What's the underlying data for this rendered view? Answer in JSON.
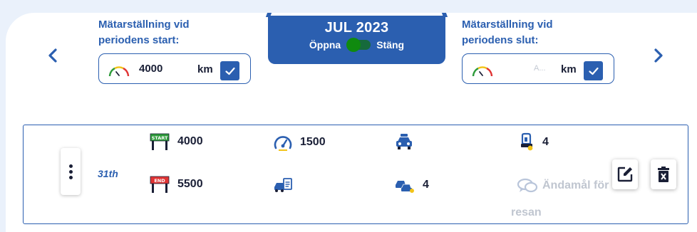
{
  "nav": {
    "prev_icon": "chevron-left-icon",
    "next_icon": "chevron-right-icon"
  },
  "start_reading": {
    "label_line1": "Mätarställning vid",
    "label_line2": "periodens start:",
    "value": "4000",
    "unit": "km",
    "icon": "speedometer-icon"
  },
  "end_reading": {
    "label_line1": "Mätarställning vid",
    "label_line2": "periodens slut:",
    "value": "",
    "placeholder": "A...",
    "unit": "km",
    "icon": "speedometer-icon"
  },
  "period": {
    "title": "JUL 2023",
    "open_label": "Öppna",
    "close_label": "Stäng",
    "toggle_state": "open"
  },
  "trip": {
    "day": "31th",
    "start_odometer": "4000",
    "end_odometer": "5500",
    "distance": "1500",
    "passengers": "4",
    "cars": "4",
    "purpose_placeholder": "Ändamål för resan"
  },
  "colors": {
    "accent": "#2b5fb0",
    "background": "#eaf1fb",
    "toggle_green": "#0f8a0f",
    "start_sign": "#2e9b3a",
    "end_sign": "#e03434",
    "highlight_yellow": "#f2c318"
  }
}
